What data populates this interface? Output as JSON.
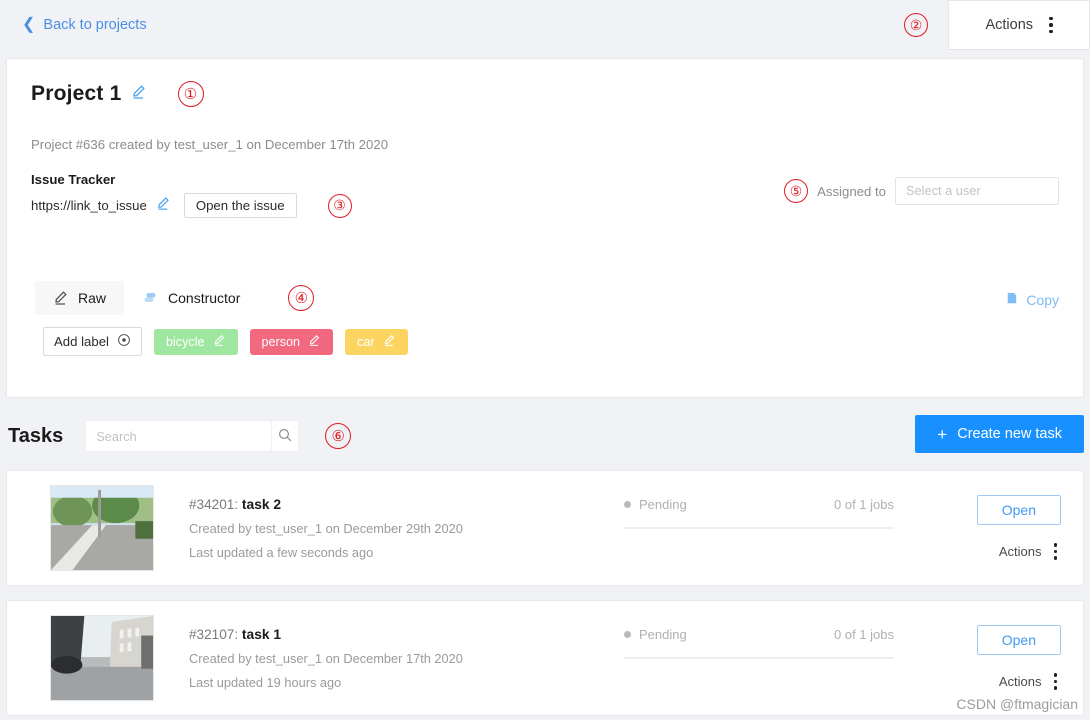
{
  "topbar": {
    "back_label": "Back to projects",
    "back_icon": "chevron-left-icon",
    "actions_label": "Actions",
    "actions_icon": "kebab-menu-icon",
    "marker": "②"
  },
  "project": {
    "title": "Project 1",
    "edit_icon": "pencil-edit-icon",
    "marker": "①",
    "meta": "Project #636 created by test_user_1 on December 17th 2020",
    "issue_tracker_label": "Issue Tracker",
    "issue_link": "https://link_to_issue",
    "issue_edit_icon": "pencil-edit-icon",
    "open_issue_label": "Open the issue",
    "issue_marker": "③",
    "assigned_label": "Assigned to",
    "assigned_placeholder": "Select a user",
    "assigned_value": "",
    "assigned_marker": "⑤"
  },
  "labels_panel": {
    "tabs": [
      {
        "label": "Raw",
        "icon": "pencil-edit-icon",
        "active": true
      },
      {
        "label": "Constructor",
        "icon": "constructor-tool-icon",
        "active": false
      }
    ],
    "tabs_marker": "④",
    "copy_label": "Copy",
    "copy_icon": "copy-icon",
    "add_label_button": "Add label",
    "add_label_icon": "plus-circle-icon",
    "chips": [
      {
        "name": "bicycle",
        "color": "#9fe7a0",
        "icon": "pencil-edit-icon"
      },
      {
        "name": "person",
        "color": "#f2697f",
        "icon": "pencil-edit-icon"
      },
      {
        "name": "car",
        "color": "#fcd462",
        "icon": "pencil-edit-icon"
      }
    ]
  },
  "tasks_section": {
    "title": "Tasks",
    "search_placeholder": "Search",
    "search_value": "",
    "search_icon": "search-icon",
    "marker": "⑥",
    "create_label": "Create new task",
    "create_icon": "plus-icon",
    "create_color": "#1890ff"
  },
  "tasks": [
    {
      "id": "#34201:",
      "name": "task 2",
      "created": "Created by test_user_1 on December 29th 2020",
      "updated": "Last updated a few seconds ago",
      "status": "Pending",
      "status_color": "#b9b9b9",
      "jobs": "0 of 1 jobs",
      "progress": 0,
      "open_label": "Open",
      "actions_label": "Actions",
      "actions_icon": "kebab-menu-icon",
      "thumbnail": "road-with-pole-thumbnail"
    },
    {
      "id": "#32107:",
      "name": "task 1",
      "created": "Created by test_user_1 on December 17th 2020",
      "updated": "Last updated 19 hours ago",
      "status": "Pending",
      "status_color": "#b9b9b9",
      "jobs": "0 of 1 jobs",
      "progress": 0,
      "open_label": "Open",
      "actions_label": "Actions",
      "actions_icon": "kebab-menu-icon",
      "thumbnail": "city-street-thumbnail"
    }
  ],
  "watermark": "CSDN @ftmagician"
}
